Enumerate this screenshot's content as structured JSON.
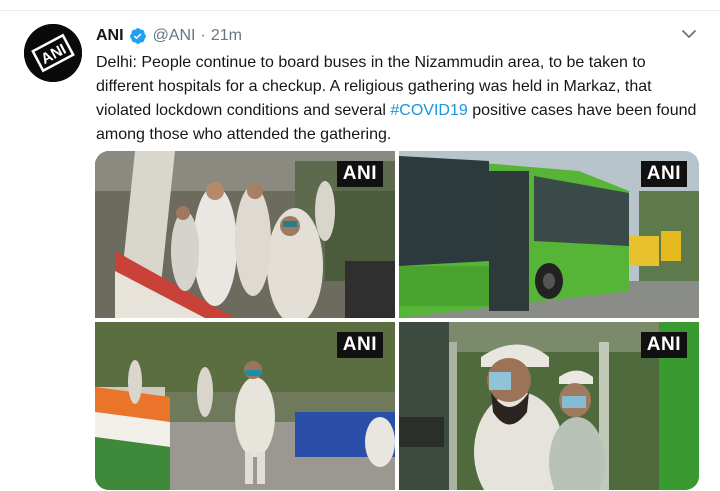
{
  "tweet": {
    "author_name": "ANI",
    "handle": "@ANI",
    "separator": "·",
    "time": "21m",
    "text_before": "Delhi: People continue to board buses in the Nizammudin area, to be taken to different hospitals for a checkup. A religious gathering was held in Markaz, that violated lockdown conditions and several ",
    "hashtag": "#COVID19",
    "text_after": " positive cases have been found among those who attended the gathering.",
    "avatar_logo_text": "ANI",
    "verified_icon": "verified-badge-icon",
    "more_icon": "chevron-down-icon",
    "hashtag_color": "#1b95e0"
  },
  "media": {
    "watermarks": [
      "ANI",
      "ANI",
      "ANI",
      "ANI"
    ]
  }
}
